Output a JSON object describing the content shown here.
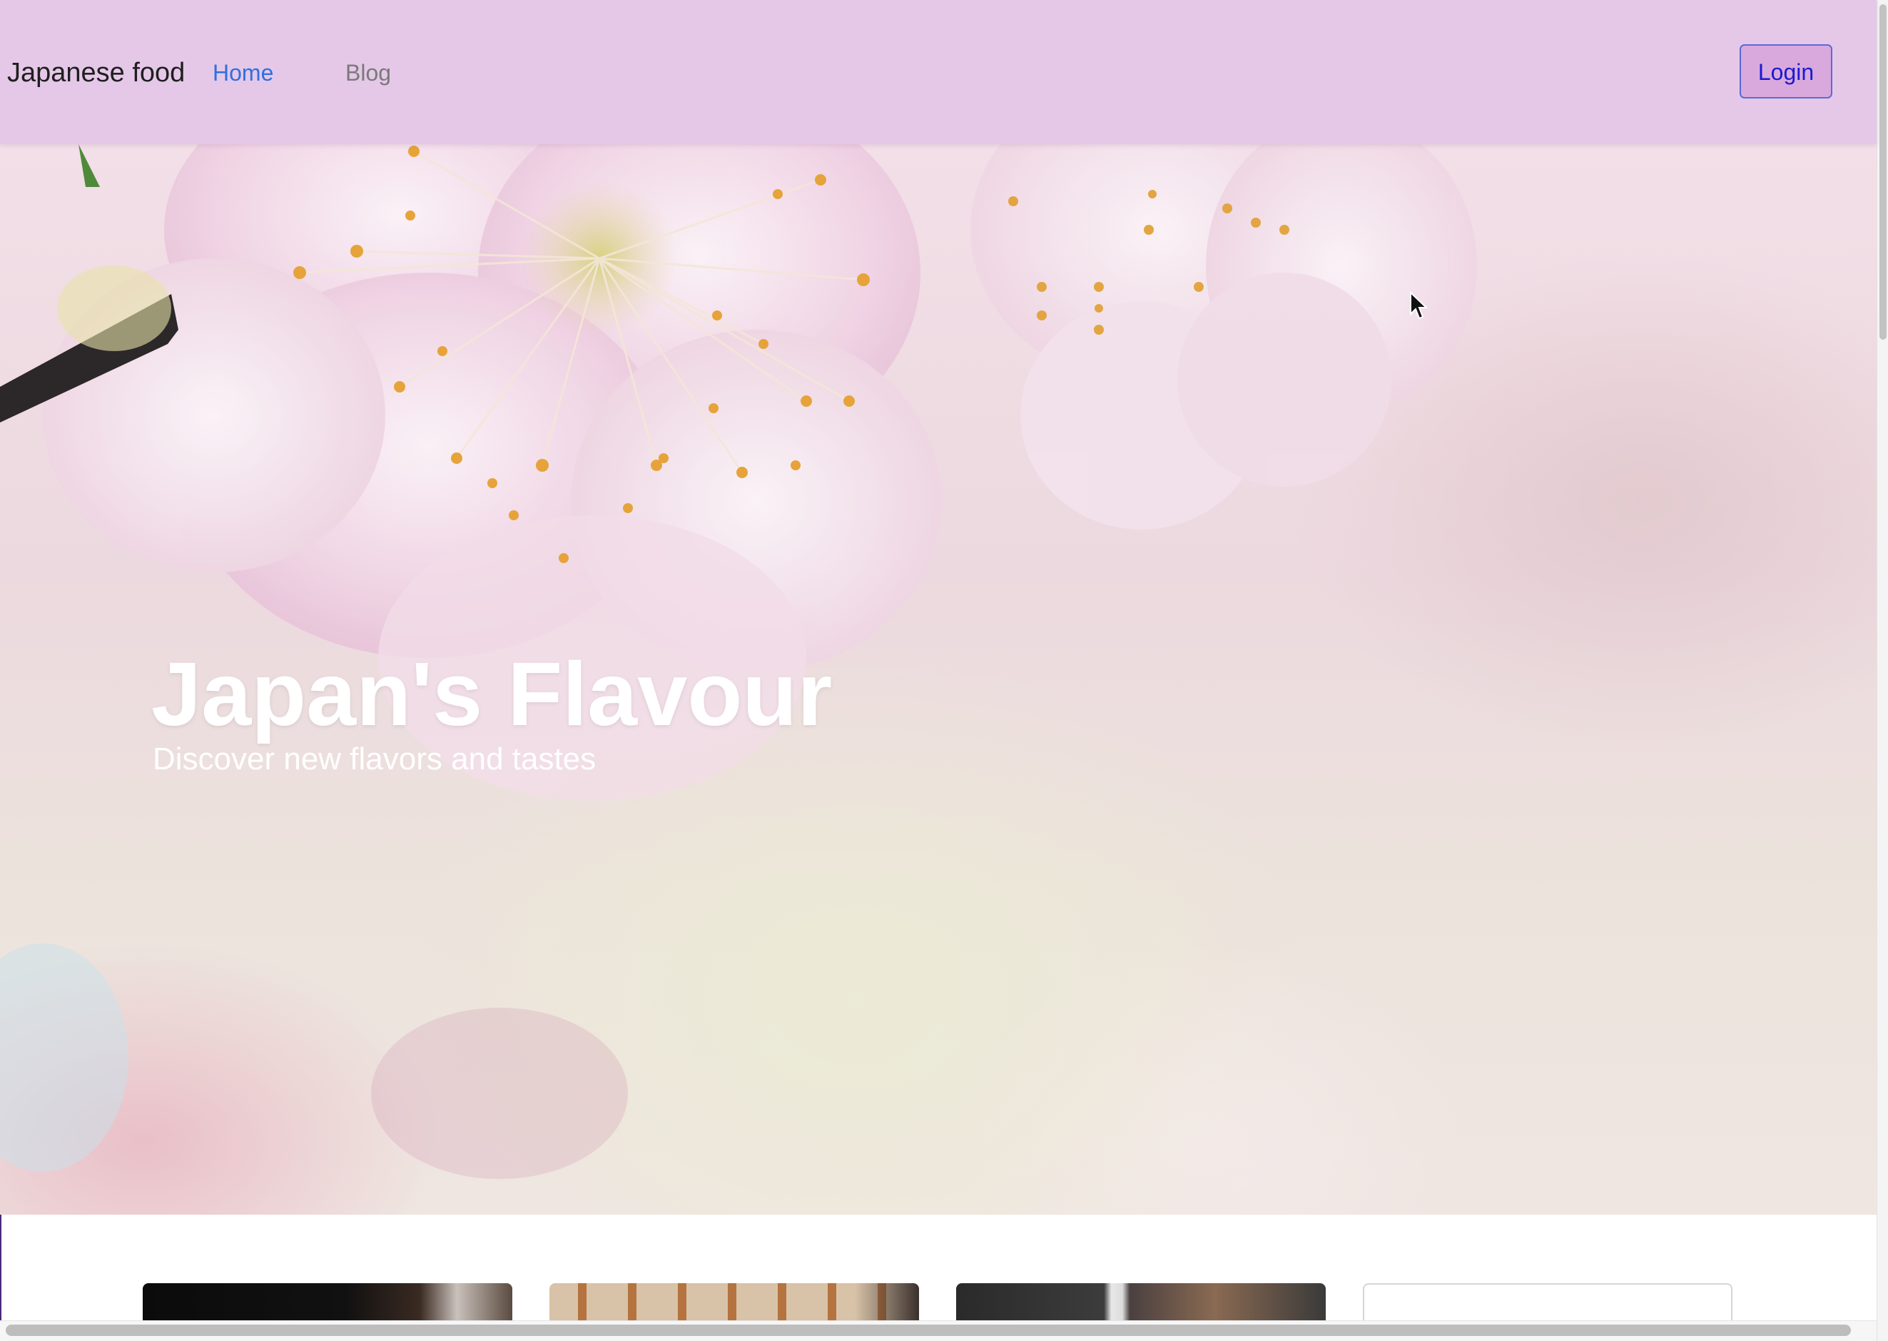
{
  "navbar": {
    "brand": "Japanese food",
    "links": [
      {
        "label": "Home",
        "active": true
      },
      {
        "label": "Blog",
        "active": false
      }
    ],
    "login_label": "Login"
  },
  "hero": {
    "title": "Japan's Flavour",
    "subtitle": "Discover new flavors and tastes",
    "background_image": "cherry-blossom"
  },
  "cards": [
    {
      "image": "chef-photo"
    },
    {
      "image": "pattern-photo"
    },
    {
      "image": "kitchen-photo"
    },
    {
      "image": ""
    }
  ],
  "colors": {
    "navbar_bg": "#e5c8e8",
    "link_active": "#2f6fe0",
    "link_inactive": "#7a7a7a",
    "login_bg": "#d9a9dd",
    "login_border": "#5b6ad8",
    "login_text": "#1a1ad0"
  },
  "icons": {
    "cursor": "mouse-pointer-icon"
  }
}
